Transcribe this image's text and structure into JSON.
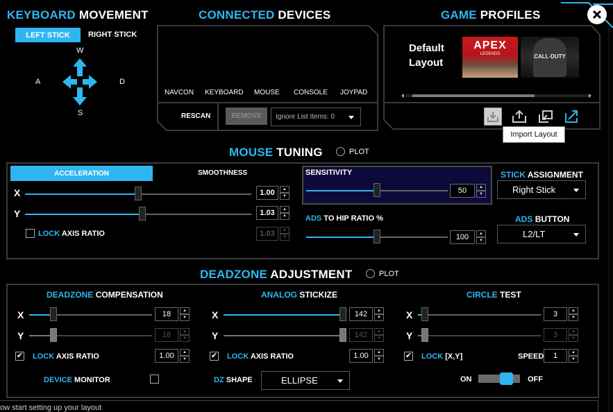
{
  "header": {
    "keyboard_movement": {
      "a": "KEYBOARD",
      "b": "MOVEMENT"
    },
    "connected_devices": {
      "a": "CONNECTED",
      "b": "DEVICES"
    },
    "game_profiles": {
      "a": "GAME",
      "b": "PROFILES"
    }
  },
  "keyboard": {
    "tabs": [
      "LEFT STICK",
      "RIGHT STICK"
    ],
    "keys": {
      "up": "W",
      "left": "A",
      "right": "D",
      "down": "S"
    }
  },
  "devices": {
    "list": [
      "NAVCON",
      "KEYBOARD",
      "MOUSE",
      "CONSOLE",
      "JOYPAD"
    ],
    "rescan": "RESCAN",
    "remove": "REMOVE",
    "ignore_list": "Ignore List Items: 0"
  },
  "profiles": {
    "default_label": "Default Layout",
    "apex_label": "APEX",
    "apex_sub": "LEGENDS",
    "cod_label": "CALL·DUTY",
    "tooltip": "Import Layout"
  },
  "mouse_tuning": {
    "title": {
      "a": "MOUSE",
      "b": "TUNING"
    },
    "plot": "PLOT",
    "tabs": [
      "ACCELERATION",
      "SMOOTHNESS"
    ],
    "x_label": "X",
    "y_label": "Y",
    "x_value": "1.00",
    "y_value": "1.03",
    "lock_value": "1.03",
    "x_level": 0.5,
    "y_level": 0.52,
    "lock_axis": {
      "a": "LOCK",
      "b": "AXIS RATIO"
    },
    "sensitivity_label": "SENSITIVITY",
    "sensitivity_value": "50",
    "sensitivity_level": 0.5,
    "ads_label": {
      "a": "ADS",
      "b": "TO HIP RATIO %"
    },
    "ads_value": "100",
    "ads_level": 0.5,
    "stick_assignment": {
      "a": "STICK",
      "b": "ASSIGNMENT"
    },
    "stick_value": "Right Stick",
    "ads_button": {
      "a": "ADS",
      "b": "BUTTON"
    },
    "ads_button_value": "L2/LT"
  },
  "deadzone": {
    "title": {
      "a": "DEADZONE",
      "b": "ADJUSTMENT"
    },
    "plot": "PLOT",
    "compensation": {
      "title": {
        "a": "DEADZONE",
        "b": "COMPENSATION"
      },
      "x_value": "18",
      "y_value": "18",
      "ratio": "1.00",
      "x_level": 0.18,
      "y_level": 0.18
    },
    "stickize": {
      "title": {
        "a": "ANALOG",
        "b": "STICKIZE"
      },
      "x_value": "142",
      "y_value": "142",
      "ratio": "1.00",
      "x_level": 1.0,
      "y_level": 1.0
    },
    "circle": {
      "title": {
        "a": "CIRCLE",
        "b": "TEST"
      },
      "x_value": "3",
      "y_value": "3",
      "speed": "1",
      "x_level": 0.03,
      "y_level": 0.03
    },
    "x_label": "X",
    "y_label": "Y",
    "lock_axis": {
      "a": "LOCK",
      "b": "AXIS RATIO"
    },
    "lock_xy": {
      "a": "LOCK",
      "b": "[X,Y]"
    },
    "speed_label": "SPEED",
    "device_monitor": {
      "a": "DEVICE",
      "b": "MONITOR"
    },
    "dz_shape": {
      "a": "DZ",
      "b": "SHAPE"
    },
    "dz_shape_value": "ELLIPSE",
    "on": "ON",
    "off": "OFF"
  },
  "status": "ow start setting up your layout"
}
